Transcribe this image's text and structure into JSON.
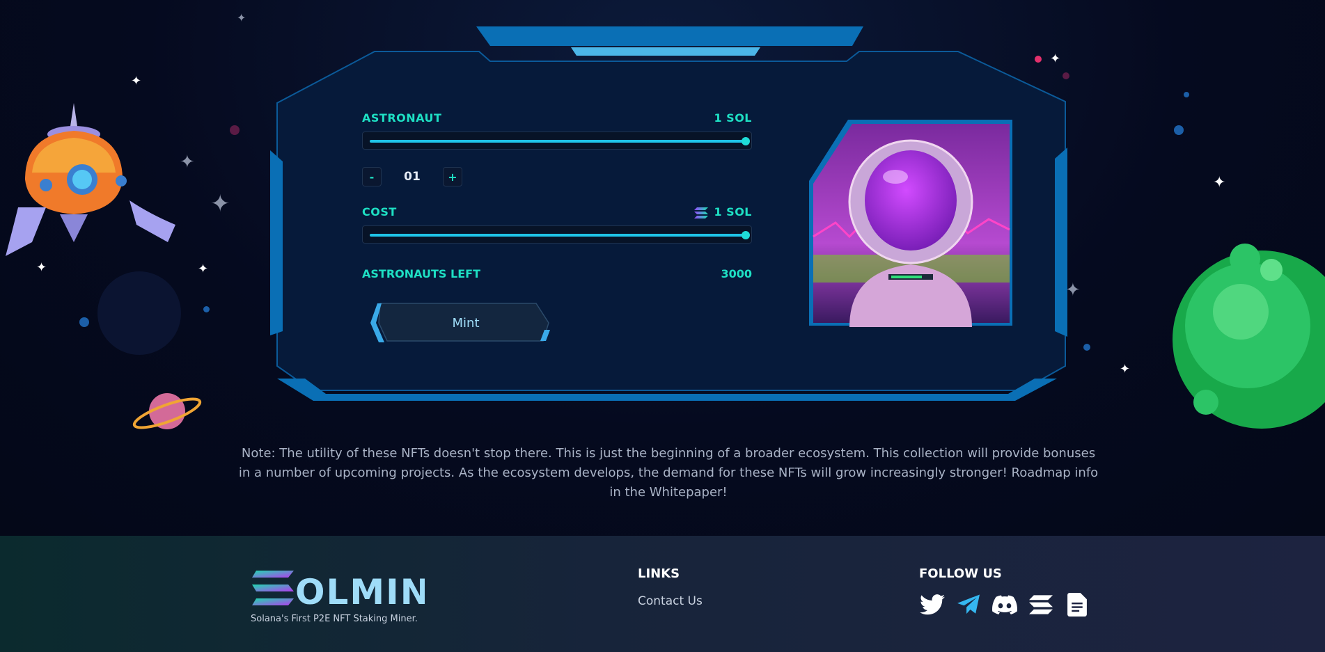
{
  "mint": {
    "item_label": "ASTRONAUT",
    "item_price": "1 SOL",
    "quantity_slider_fraction": 1.0,
    "quantity": "01",
    "decrement_label": "-",
    "increment_label": "+",
    "cost_label": "COST",
    "cost_value": "1 SOL",
    "cost_slider_fraction": 1.0,
    "left_label": "ASTRONAUTS LEFT",
    "left_value": "3000",
    "mint_button": "Mint"
  },
  "note": "Note: The utility of these NFTs doesn't stop there. This is just the beginning of a broader ecosystem. This collection will provide bonuses in a number of upcoming projects. As the ecosystem develops, the demand for these NFTs will grow increasingly stronger! Roadmap info in the Whitepaper!",
  "footer": {
    "brand": "SOLMINE",
    "tagline": "Solana's First P2E NFT Staking Miner.",
    "links_title": "LINKS",
    "links": [
      "Contact Us"
    ],
    "follow_title": "FOLLOW US",
    "socials": [
      "twitter-icon",
      "telegram-icon",
      "discord-icon",
      "solana-icon",
      "document-icon"
    ]
  },
  "colors": {
    "accent": "#1ee0c4",
    "frame_blue": "#0a6fb5",
    "background": "#050a1f"
  }
}
